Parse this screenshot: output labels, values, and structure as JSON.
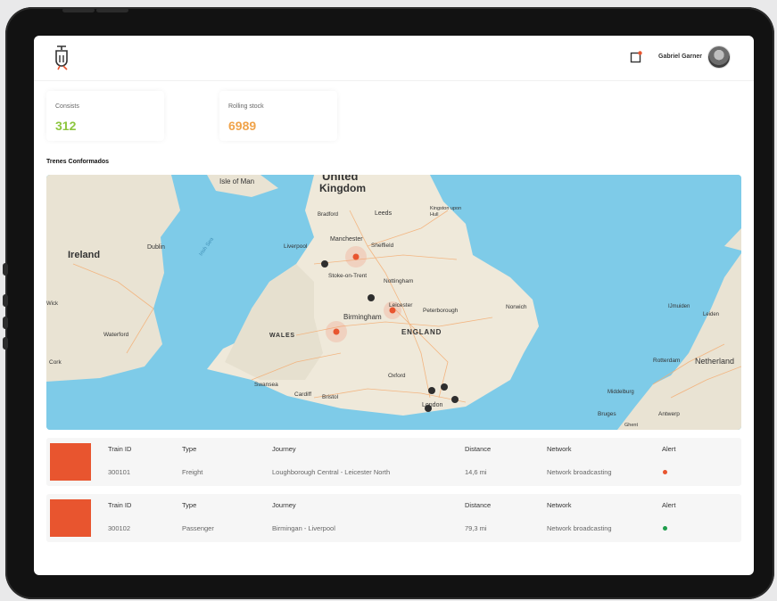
{
  "header": {
    "user_name": "Gabriel Garner",
    "logo_icon": "train-logo-icon",
    "notification_icon": "notification-icon"
  },
  "stats": [
    {
      "label": "Consists",
      "value": "312",
      "color": "#8dc63f"
    },
    {
      "label": "Rolling stock",
      "value": "6989",
      "color": "#f0a34a"
    }
  ],
  "section_title": "Trenes Conformados",
  "map": {
    "labels": {
      "isle_of_man": "Isle of Man",
      "kingdom": "Kingdom",
      "united": "United",
      "ireland": "Ireland",
      "dublin": "Dublin",
      "wales": "WALES",
      "england": "ENGLAND",
      "birmingham": "Birmingham",
      "manchester": "Manchester",
      "leeds": "Leeds",
      "liverpool": "Liverpool",
      "sheffield": "Sheffield",
      "nottingham": "Nottingham",
      "leicester": "Leicester",
      "peterborough": "Peterborough",
      "norwich": "Norwich",
      "stoke": "Stoke-on-Trent",
      "oxford": "Oxford",
      "cardiff": "Cardiff",
      "bristol": "Bristol",
      "swansea": "Swansea",
      "london": "London",
      "waterford": "Waterford",
      "cork": "Cork",
      "netherlands": "Netherland",
      "rotterdam": "Rotterdam",
      "antwerp": "Antwerp",
      "bruges": "Bruges",
      "ghent": "Ghent",
      "middelburg": "Middelburg",
      "kingston": "Kingston upon Hull",
      "irish_sea": "Irish Sea",
      "bradford": "Bradford",
      "ijmuiden": "IJmuiden",
      "leiden": "Leiden",
      "wick": "Wick"
    }
  },
  "table": {
    "headers": [
      "Train ID",
      "Type",
      "Journey",
      "Distance",
      "Network",
      "Alert"
    ],
    "rows": [
      {
        "train_id": "300101",
        "type": "Freight",
        "journey": "Loughborough Central - Leicester North",
        "distance": "14,6 mi",
        "network": "Network broadcasting",
        "alert_color": "#e8552f"
      },
      {
        "train_id": "300102",
        "type": "Passenger",
        "journey": "Birmingan - Liverpool",
        "distance": "79,3 mi",
        "network": "Network broadcasting",
        "alert_color": "#1f9d4c"
      }
    ]
  }
}
